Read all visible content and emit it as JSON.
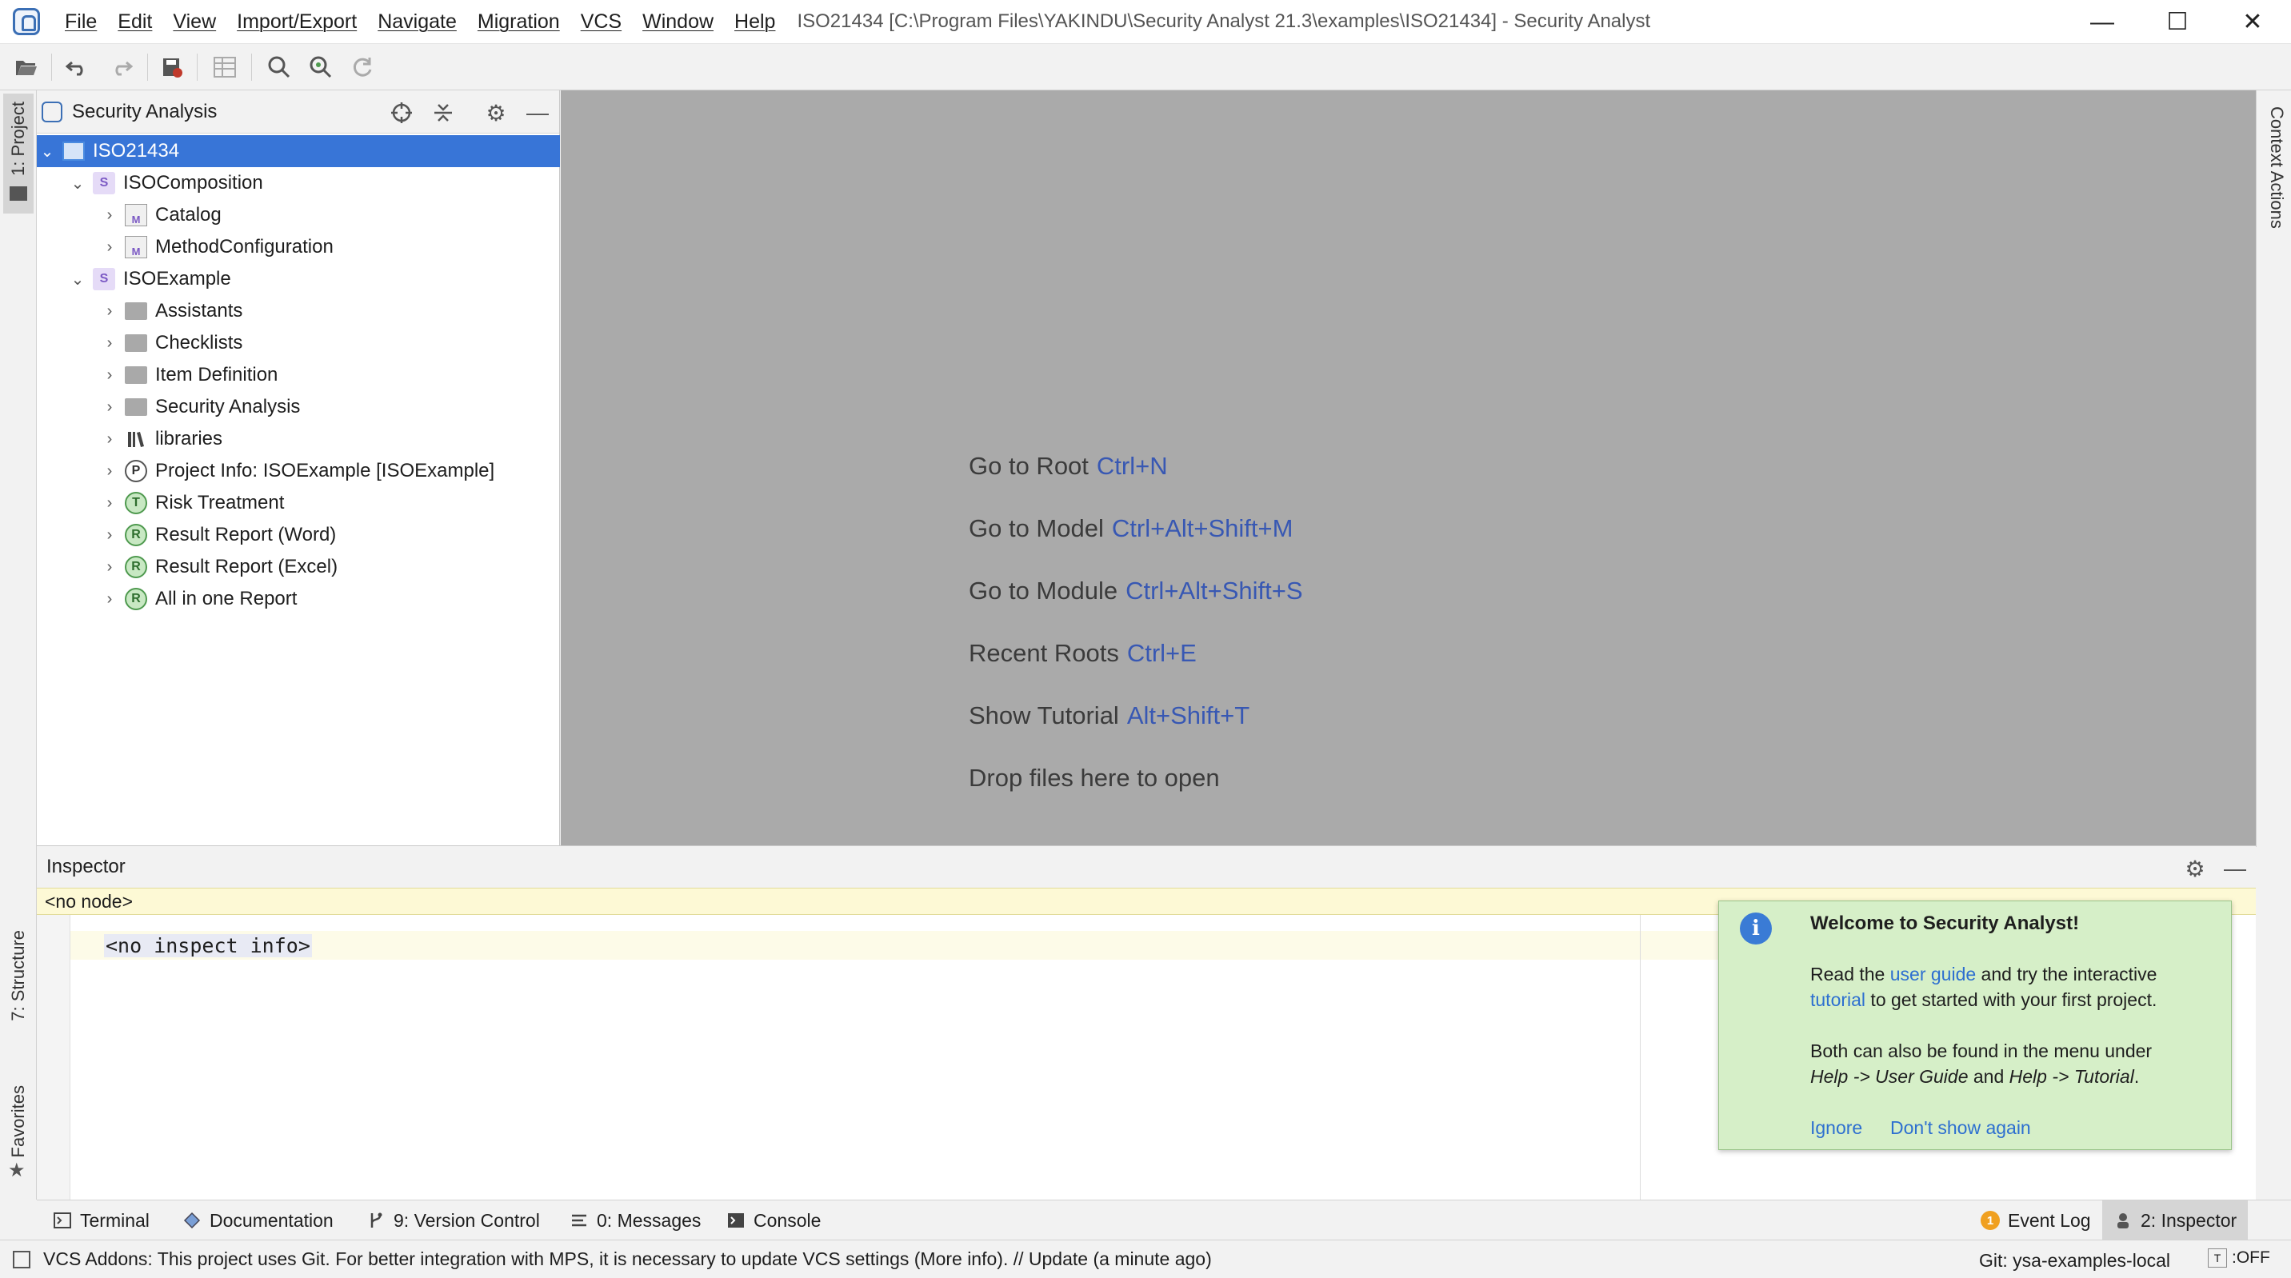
{
  "titlebar": {
    "menu": [
      "File",
      "Edit",
      "View",
      "Import/Export",
      "Navigate",
      "Migration",
      "VCS",
      "Window",
      "Help"
    ],
    "window_title": "ISO21434 [C:\\Program Files\\YAKINDU\\Security Analyst 21.3\\examples\\ISO21434] - Security Analyst",
    "controls": [
      "—",
      "☐",
      "✕"
    ]
  },
  "toolbar": {
    "icons": [
      "open-folder-icon",
      "undo-icon",
      "redo-icon",
      "save-all-icon",
      "table-icon",
      "search-in-models-icon",
      "find-usages-icon",
      "refresh-icon"
    ]
  },
  "left_stripe": {
    "project_tab": "1: Project",
    "structure_tab": "7: Structure",
    "favorites_tab": "Favorites"
  },
  "right_stripe": {
    "context_actions_tab": "Context Actions"
  },
  "project_panel": {
    "title": "Security Analysis",
    "tree": [
      {
        "label": "ISO21434",
        "icon": "project",
        "level": 0,
        "expanded": true,
        "selected": true
      },
      {
        "label": "ISOComposition",
        "icon": "module",
        "level": 1,
        "expanded": true
      },
      {
        "label": "Catalog",
        "icon": "model",
        "level": 2,
        "expanded": false
      },
      {
        "label": "MethodConfiguration",
        "icon": "model",
        "level": 2,
        "expanded": false
      },
      {
        "label": "ISOExample",
        "icon": "module",
        "level": 1,
        "expanded": true
      },
      {
        "label": "Assistants",
        "icon": "folder",
        "level": 2,
        "expanded": false
      },
      {
        "label": "Checklists",
        "icon": "folder",
        "level": 2,
        "expanded": false
      },
      {
        "label": "Item Definition",
        "icon": "folder",
        "level": 2,
        "expanded": false
      },
      {
        "label": "Security Analysis",
        "icon": "folder",
        "level": 2,
        "expanded": false
      },
      {
        "label": "libraries",
        "icon": "libraries",
        "level": 2,
        "expanded": false
      },
      {
        "label": "Project Info: ISOExample [ISOExample]",
        "icon": "P",
        "level": 2,
        "expanded": false
      },
      {
        "label": "Risk Treatment",
        "icon": "T",
        "level": 2,
        "expanded": false
      },
      {
        "label": "Result Report (Word)",
        "icon": "R",
        "level": 2,
        "expanded": false
      },
      {
        "label": "Result Report (Excel)",
        "icon": "R",
        "level": 2,
        "expanded": false
      },
      {
        "label": "All in one Report",
        "icon": "R",
        "level": 2,
        "expanded": false
      }
    ]
  },
  "editor": {
    "hints": [
      {
        "text": "Go to Root",
        "shortcut": "Ctrl+N"
      },
      {
        "text": "Go to Model",
        "shortcut": "Ctrl+Alt+Shift+M"
      },
      {
        "text": "Go to Module",
        "shortcut": "Ctrl+Alt+Shift+S"
      },
      {
        "text": "Recent Roots",
        "shortcut": "Ctrl+E"
      },
      {
        "text": "Show Tutorial",
        "shortcut": "Alt+Shift+T"
      },
      {
        "text": "Drop files here to open",
        "shortcut": ""
      }
    ]
  },
  "inspector": {
    "title": "Inspector",
    "no_node": "<no node>",
    "content": "<no inspect info>"
  },
  "notification": {
    "title": "Welcome to Security Analyst!",
    "line1_a": "Read the ",
    "line1_link": "user guide",
    "line1_b": " and try the interactive",
    "line2_link": "tutorial",
    "line2_b": " to get started with your first project.",
    "line3": "Both can also be found in the menu under",
    "line4_a": "Help -> User Guide",
    "line4_b": " and ",
    "line4_c": "Help -> Tutorial",
    "line4_d": ".",
    "action_ignore": "Ignore",
    "action_dont_show": "Don't show again"
  },
  "bottom_bar": {
    "terminal": "Terminal",
    "documentation": "Documentation",
    "version_control": "9: Version Control",
    "messages": "0: Messages",
    "console": "Console",
    "event_log_count": "1",
    "event_log": "Event Log",
    "inspector": "2: Inspector"
  },
  "statusbar": {
    "message": "VCS Addons: This project uses Git. For better integration with MPS, it is necessary to update VCS settings (More info). // Update (a minute ago)",
    "git_branch": "Git: ysa-examples-local",
    "toggle_icon": "T",
    "toggle_state": ":OFF"
  },
  "colors": {
    "selection": "#3875d7",
    "editor_bg": "#aaaaaa",
    "shortcut": "#3858b3",
    "notification_bg": "#d6efc8",
    "link": "#2d6fd0"
  }
}
